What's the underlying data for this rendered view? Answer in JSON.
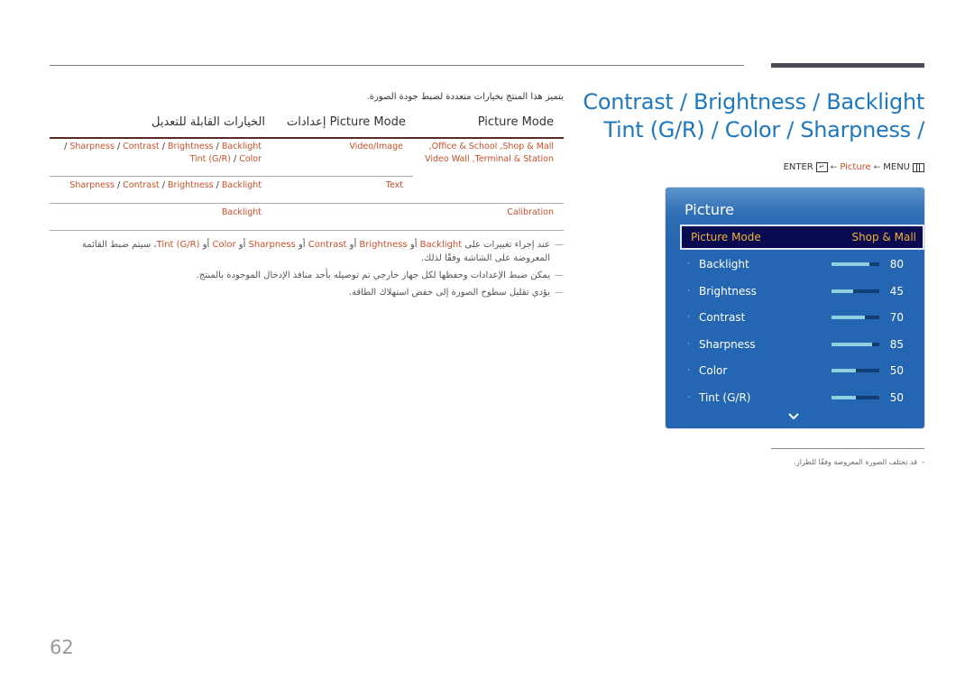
{
  "header": {
    "title_line1": "Contrast / Brightness / Backlight",
    "title_line2": "Tint (G/R) / Color / Sharpness /",
    "breadcrumb": {
      "enter": "ENTER",
      "enter_icon": "enter-icon",
      "arrow": "←",
      "picture": "Picture",
      "menu": "MENU",
      "menu_icon": "menu-icon"
    }
  },
  "intro": "يتميز هذا المنتج بخيارات متعددة لضبط جودة الصورة.",
  "table": {
    "headers": [
      "Picture Mode",
      "إعدادات Picture Mode",
      "الخيارات القابلة للتعديل"
    ],
    "rows": [
      {
        "mode": ",Office & School ,Shop & Mall\nVideo Wall ,Terminal & Station",
        "setting": "Video/Image",
        "options": [
          "Sharpness",
          "Contrast",
          "Brightness",
          "Backlight",
          "Tint (G/R)",
          "Color"
        ]
      },
      {
        "mode": "",
        "setting": "Text",
        "options": [
          "Sharpness",
          "Contrast",
          "Brightness",
          "Backlight"
        ]
      },
      {
        "mode": "Calibration",
        "setting": "",
        "options": [
          "Backlight"
        ]
      }
    ]
  },
  "notes": [
    {
      "pre": "عند إجراء تغييرات على ",
      "items": [
        "Backlight",
        "Brightness",
        "Contrast",
        "Sharpness",
        "Color",
        "Tint (G/R)"
      ],
      "joiner": " أو ",
      "post": "، سيتم ضبط القائمة المعروضة على الشاشة وفقًا لذلك."
    },
    {
      "text": "يمكن ضبط الإعدادات وحفظها لكل جهاز خارجي تم توصيله بأحد منافذ الإدخال الموجودة بالمنتج."
    },
    {
      "text": "يؤدي تقليل سطوح الصورة إلى خفض استهلاك الطاقة."
    }
  ],
  "osd": {
    "title": "Picture",
    "selected": {
      "label": "Picture Mode",
      "value": "Shop & Mall"
    },
    "items": [
      {
        "label": "Backlight",
        "value": "80",
        "level": 0.8
      },
      {
        "label": "Brightness",
        "value": "45",
        "level": 0.45
      },
      {
        "label": "Contrast",
        "value": "70",
        "level": 0.7
      },
      {
        "label": "Sharpness",
        "value": "85",
        "level": 0.85
      },
      {
        "label": "Color",
        "value": "50",
        "level": 0.5
      },
      {
        "label": "Tint (G/R)",
        "value": "50",
        "level": 0.5
      }
    ],
    "more_icon": "chevron-down-icon",
    "colors": {
      "panel": "#2466b1",
      "selected_bg": "#090a4f",
      "selected_text": "#f0b43a",
      "slider_fill": "#8fd0e0"
    }
  },
  "footnote": "قد تختلف الصورة المعروضة وفقًا للطراز.",
  "page_number": "62",
  "colors": {
    "title": "#1f78be",
    "accent": "#c8502a"
  }
}
